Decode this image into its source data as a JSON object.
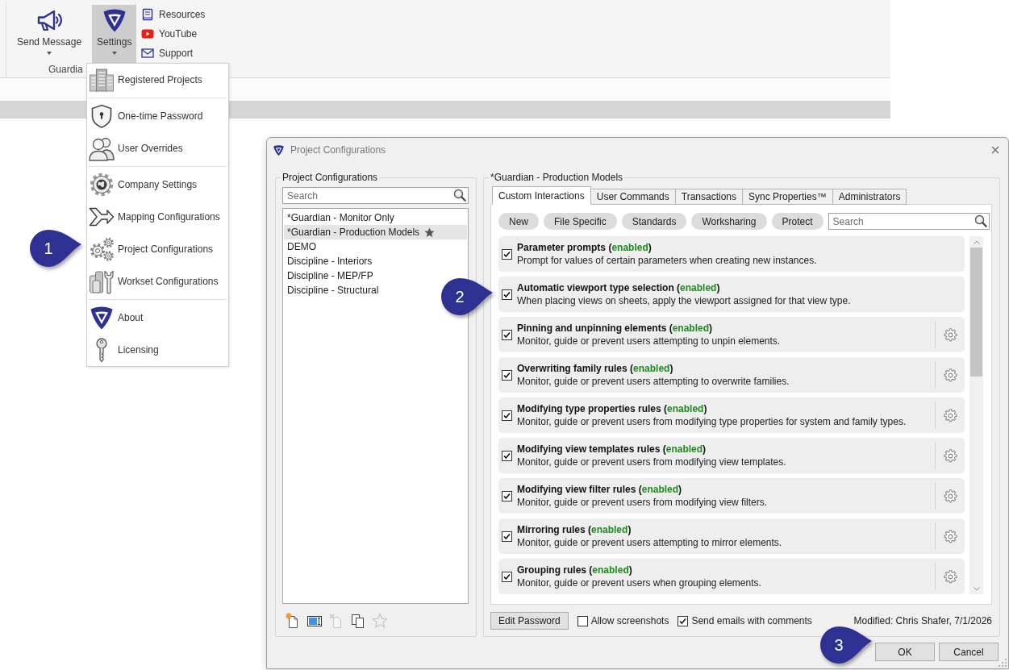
{
  "ribbon": {
    "buttons": [
      {
        "kind": "megaphone",
        "label": "Send Message",
        "selected": false,
        "has_menu": true
      },
      {
        "kind": "logo",
        "label": "Settings",
        "selected": true,
        "has_menu": true
      }
    ],
    "group_label": "Guardia",
    "links": [
      {
        "kind": "book",
        "label": "Resources"
      },
      {
        "kind": "video",
        "label": "YouTube"
      },
      {
        "kind": "envelope",
        "label": "Support"
      }
    ]
  },
  "settings_menu": {
    "groups": [
      {
        "items": [
          {
            "kind": "buildings",
            "label": "Registered Projects"
          }
        ]
      },
      {
        "items": [
          {
            "kind": "shield",
            "label": "One-time Password"
          },
          {
            "kind": "users",
            "label": "User Overrides"
          }
        ]
      },
      {
        "items": [
          {
            "kind": "globe-gear",
            "label": "Company Settings"
          },
          {
            "kind": "merge-arrow",
            "label": "Mapping Configurations"
          },
          {
            "kind": "gears",
            "label": "Project Configurations"
          },
          {
            "kind": "buildings-wrench",
            "label": "Workset Configurations"
          }
        ]
      },
      {
        "items": [
          {
            "kind": "logo",
            "label": "About"
          },
          {
            "kind": "key",
            "label": "Licensing"
          }
        ]
      }
    ]
  },
  "dialog": {
    "title": "Project Configurations",
    "configurations": {
      "heading": "Project Configurations",
      "search": {
        "placeholder": "Search"
      },
      "items": [
        {
          "label": "*Guardian - Monitor Only",
          "selected": false,
          "favorite": false
        },
        {
          "label": "*Guardian - Production Models",
          "selected": true,
          "favorite": true
        },
        {
          "label": "DEMO",
          "selected": false,
          "favorite": false
        },
        {
          "label": "Discipline - Interiors",
          "selected": false,
          "favorite": false
        },
        {
          "label": "Discipline - MEP/FP",
          "selected": false,
          "favorite": false
        },
        {
          "label": "Discipline - Structural",
          "selected": false,
          "favorite": false
        }
      ],
      "tools": [
        {
          "kind": "new",
          "disabled": false
        },
        {
          "kind": "rename",
          "disabled": false
        },
        {
          "kind": "delete",
          "disabled": true
        },
        {
          "kind": "copy",
          "disabled": false
        },
        {
          "kind": "favorite",
          "disabled": true
        }
      ]
    },
    "details": {
      "heading": "*Guardian - Production Models",
      "tabs": [
        {
          "label": "Custom Interactions",
          "selected": true
        },
        {
          "label": "User Commands",
          "selected": false
        },
        {
          "label": "Transactions",
          "selected": false
        },
        {
          "label": "Sync Properties™",
          "selected": false
        },
        {
          "label": "Administrators",
          "selected": false
        }
      ],
      "filters": [
        "New",
        "File Specific",
        "Standards",
        "Worksharing",
        "Protect"
      ],
      "search": {
        "placeholder": "Search"
      },
      "rules": [
        {
          "title": "Parameter prompts",
          "status": "(enabled)",
          "enabled": true,
          "checked": true,
          "settings": false,
          "description": "Prompt for values of certain parameters when creating new instances."
        },
        {
          "title": "Automatic viewport type selection",
          "status": "(enabled)",
          "enabled": true,
          "checked": true,
          "settings": false,
          "description": "When placing views on sheets, apply the viewport assigned for that view type."
        },
        {
          "title": "Pinning and unpinning elements",
          "status": "(enabled)",
          "enabled": true,
          "checked": true,
          "settings": true,
          "description": "Monitor, guide or prevent users attempting to unpin elements."
        },
        {
          "title": "Overwriting family rules",
          "status": "(enabled)",
          "enabled": true,
          "checked": true,
          "settings": true,
          "description": "Monitor, guide or prevent users attempting to overwrite families."
        },
        {
          "title": "Modifying type properties rules",
          "status": "(enabled)",
          "enabled": true,
          "checked": true,
          "settings": true,
          "description": "Monitor, guide or prevent users from modifying type properties for system and family types."
        },
        {
          "title": "Modifying view templates rules",
          "status": "(enabled)",
          "enabled": true,
          "checked": true,
          "settings": true,
          "description": "Monitor, guide or prevent users from modifying view templates."
        },
        {
          "title": "Modifying view filter rules",
          "status": "(enabled)",
          "enabled": true,
          "checked": true,
          "settings": true,
          "description": "Monitor, guide or prevent users from modifying view filters."
        },
        {
          "title": "Mirroring rules",
          "status": "(enabled)",
          "enabled": true,
          "checked": true,
          "settings": true,
          "description": "Monitor, guide or prevent users attempting to mirror elements."
        },
        {
          "title": "Grouping rules",
          "status": "(enabled)",
          "enabled": true,
          "checked": true,
          "settings": true,
          "description": "Monitor, guide or prevent users when grouping elements."
        }
      ],
      "edit_password": "Edit Password",
      "options": [
        {
          "label": "Allow screenshots",
          "checked": false
        },
        {
          "label": "Send emails with comments",
          "checked": true
        }
      ],
      "modified": "Modified: Chris Shafer, 7/1/2026"
    },
    "buttons": [
      "OK",
      "Cancel"
    ]
  },
  "callouts": [
    {
      "number": "1"
    },
    {
      "number": "2"
    },
    {
      "number": "3"
    }
  ]
}
